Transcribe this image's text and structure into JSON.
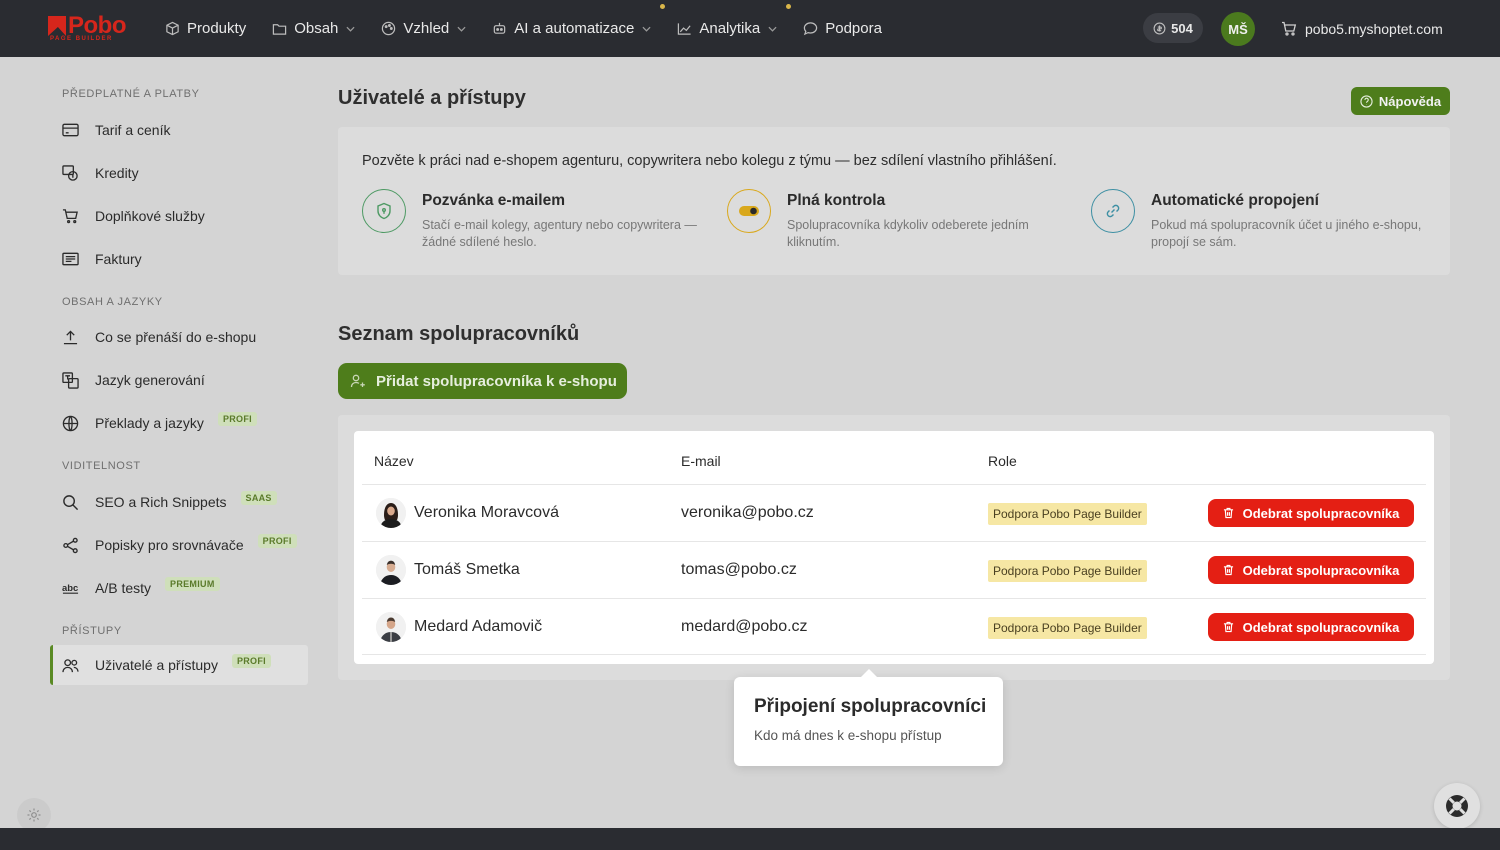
{
  "brand": {
    "name": "Pobo",
    "sub": "PAGE BUILDER"
  },
  "nav": {
    "items": [
      {
        "label": "Produkty",
        "dropdown": false,
        "dot": false
      },
      {
        "label": "Obsah",
        "dropdown": true,
        "dot": false
      },
      {
        "label": "Vzhled",
        "dropdown": true,
        "dot": false
      },
      {
        "label": "AI a automatizace",
        "dropdown": true,
        "dot": true
      },
      {
        "label": "Analytika",
        "dropdown": true,
        "dot": true
      },
      {
        "label": "Podpora",
        "dropdown": false,
        "dot": false
      }
    ],
    "credits": "504",
    "user_initials": "MŠ",
    "shop": "pobo5.myshoptet.com"
  },
  "sidebar": {
    "sections": [
      {
        "title": "PŘEDPLATNÉ A PLATBY",
        "items": [
          {
            "label": "Tarif a ceník",
            "icon": "credit-card-icon"
          },
          {
            "label": "Kredity",
            "icon": "coins-icon"
          },
          {
            "label": "Doplňkové služby",
            "icon": "cart-icon"
          },
          {
            "label": "Faktury",
            "icon": "invoice-icon"
          }
        ]
      },
      {
        "title": "OBSAH A JAZYKY",
        "items": [
          {
            "label": "Co se přenáší do e-shopu",
            "icon": "upload-icon"
          },
          {
            "label": "Jazyk generování",
            "icon": "language-icon"
          },
          {
            "label": "Překlady a jazyky",
            "icon": "globe-icon",
            "tag": "PROFI"
          }
        ]
      },
      {
        "title": "VIDITELNOST",
        "items": [
          {
            "label": "SEO a Rich Snippets",
            "icon": "search-icon",
            "tag": "SAAS"
          },
          {
            "label": "Popisky pro srovnávače",
            "icon": "share-icon",
            "tag": "PROFI"
          },
          {
            "label": "A/B testy",
            "icon": "ab-icon",
            "tag": "PREMIUM"
          }
        ]
      },
      {
        "title": "PŘÍSTUPY",
        "items": [
          {
            "label": "Uživatelé a přístupy",
            "icon": "users-icon",
            "tag": "PROFI",
            "active": true
          }
        ]
      }
    ]
  },
  "page": {
    "title": "Uživatelé a přístupy",
    "help_label": "Nápověda",
    "intro": "Pozvěte k práci nad e-shopem agenturu, copywritera nebo kolegu z týmu — bez sdílení vlastního přihlášení.",
    "features": [
      {
        "title": "Pozvánka e-mailem",
        "desc": "Stačí e-mail kolegy, agentury nebo copywritera — žádné sdílené heslo.",
        "color": "#4e9a64"
      },
      {
        "title": "Plná kontrola",
        "desc": "Spolupracovníka kdykoliv odeberete jedním kliknutím.",
        "color": "#d9a81c"
      },
      {
        "title": "Automatické propojení",
        "desc": "Pokud má spolupracovník účet u jiného e-shopu, propojí se sám.",
        "color": "#3d8fa3"
      }
    ],
    "list_title": "Seznam spolupracovníků",
    "add_label": "Přidat spolupracovníka k e-shopu"
  },
  "table": {
    "headers": [
      "Název",
      "E-mail",
      "Role"
    ],
    "rows": [
      {
        "name": "Veronika Moravcová",
        "email": "veronika@pobo.cz",
        "role": "Podpora Pobo Page Builder",
        "action": "Odebrat spolupracovníka"
      },
      {
        "name": "Tomáš Smetka",
        "email": "tomas@pobo.cz",
        "role": "Podpora Pobo Page Builder",
        "action": "Odebrat spolupracovníka"
      },
      {
        "name": "Medard Adamovič",
        "email": "medard@pobo.cz",
        "role": "Podpora Pobo Page Builder",
        "action": "Odebrat spolupracovníka"
      }
    ]
  },
  "tooltip": {
    "title": "Připojení spolupracovníci",
    "subtitle": "Kdo má dnes k e-shopu přístup"
  },
  "colors": {
    "accent": "#4e7d1b",
    "danger": "#e41f14",
    "topbar": "#2a2c31",
    "badge": "#f6e7a4"
  }
}
